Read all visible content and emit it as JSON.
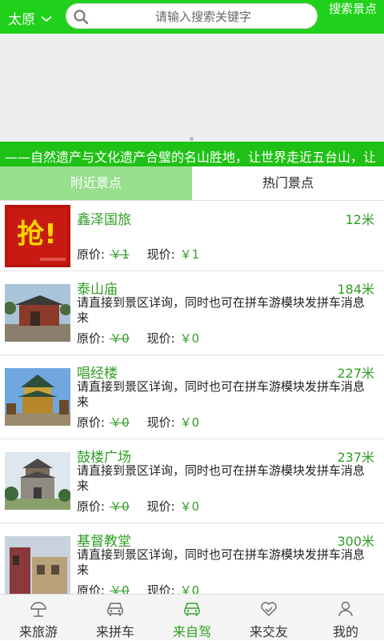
{
  "header": {
    "city": "太原",
    "search_placeholder": "请输入搜索关键字",
    "search_button": "搜索景点"
  },
  "marquee": {
    "text": "——自然遗产与文化遗产合璧的名山胜地，让世界走近五台山，让"
  },
  "tabs": [
    {
      "label": "附近景点",
      "active": true
    },
    {
      "label": "热门景点",
      "active": false
    }
  ],
  "list": {
    "items": [
      {
        "name": "鑫泽国旅",
        "distance": "12米",
        "desc": "",
        "orig_label": "原价:",
        "orig_price": "￥1",
        "cur_label": "现价:",
        "cur_price": "￥1",
        "thumb": "promo-qiang"
      },
      {
        "name": "泰山庙",
        "distance": "184米",
        "desc": "请直接到景区详询，同时也可在拼车游模块发拼车消息来",
        "orig_label": "原价:",
        "orig_price": "￥0",
        "cur_label": "现价:",
        "cur_price": "￥0",
        "thumb": "temple"
      },
      {
        "name": "唱经楼",
        "distance": "227米",
        "desc": "请直接到景区详询，同时也可在拼车游模块发拼车消息来",
        "orig_label": "原价:",
        "orig_price": "￥0",
        "cur_label": "现价:",
        "cur_price": "￥0",
        "thumb": "pavilion"
      },
      {
        "name": "鼓楼广场",
        "distance": "237米",
        "desc": "请直接到景区详询，同时也可在拼车游模块发拼车消息来",
        "orig_label": "原价:",
        "orig_price": "￥0",
        "cur_label": "现价:",
        "cur_price": "￥0",
        "thumb": "drum-tower"
      },
      {
        "name": "基督教堂",
        "distance": "300米",
        "desc": "请直接到景区详询，同时也可在拼车游模块发拼车消息来",
        "orig_label": "原价:",
        "orig_price": "￥0",
        "cur_label": "现价:",
        "cur_price": "￥0",
        "thumb": "church"
      }
    ]
  },
  "bottom_nav": [
    {
      "label": "来旅游",
      "icon": "umbrella-icon",
      "active": false
    },
    {
      "label": "来拼车",
      "icon": "car-front-icon",
      "active": false
    },
    {
      "label": "来自驾",
      "icon": "car-icon",
      "active": true
    },
    {
      "label": "来交友",
      "icon": "handshake-icon",
      "active": false
    },
    {
      "label": "我的",
      "icon": "user-icon",
      "active": false
    }
  ],
  "colors": {
    "brand": "#1fd11a",
    "accent_text": "#2f9e25",
    "tab_active": "#97df8f"
  }
}
